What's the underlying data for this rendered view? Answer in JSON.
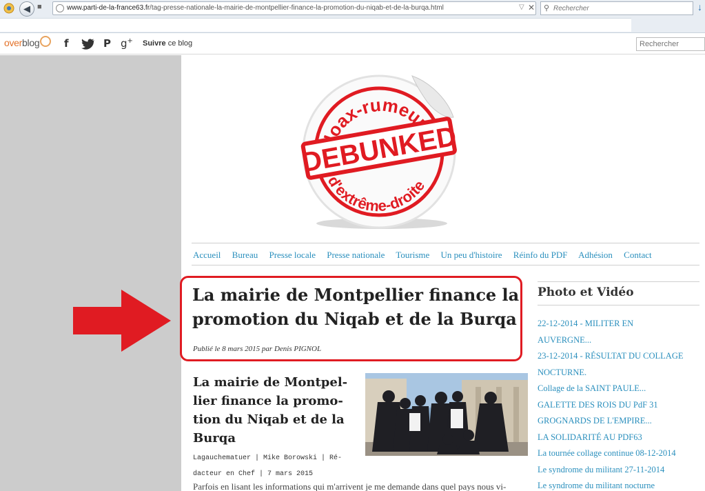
{
  "browser": {
    "url_domain": "www.parti-de-la-france63.fr",
    "url_path": "/tag-presse-nationale-la-mairie-de-montpellier-finance-la-promotion-du-niqab-et-de-la-burqa.html",
    "search_placeholder": "Rechercher"
  },
  "overblog": {
    "logo_part1": "over",
    "logo_part2": "blog",
    "follow_bold": "Suivre",
    "follow_rest": " ce blog",
    "search_placeholder": "Rechercher"
  },
  "sticker": {
    "top_text": "Hoax-rumeurs",
    "stamp_text": "DEBUNKED",
    "bottom_text": "d'extrême-droite"
  },
  "nav": [
    "Accueil",
    "Bureau",
    "Presse locale",
    "Presse nationale",
    "Tourisme",
    "Un peu d'histoire",
    "Réinfo du PDF",
    "Adhésion",
    "Contact"
  ],
  "post": {
    "title_line1": "La mairie de Montpellier finance la",
    "title_line2": "promotion du Niqab et de la Burqa",
    "byline": "Publié le 8 mars 2015 par Denis PIGNOL"
  },
  "article": {
    "title_lines": [
      "La mairie de Montpel-",
      "lier finance la promo-",
      "tion du Niqab et de la",
      "Burqa"
    ],
    "meta_line1": "Lagauchematuer | Mike Borowski | Ré-",
    "meta_line2": "dacteur en Chef | 7 mars 2015",
    "text_start": "Parfois en lisant les informations qui m'arrivent je me demande dans quel pays nous vi-"
  },
  "sidebar": {
    "title": "Photo et Vidéo",
    "items": [
      "22-12-2014 - MILITER EN",
      "AUVERGNE...",
      "23-12-2014 - RÉSULTAT DU COLLAGE",
      "NOCTURNE.",
      "Collage de la SAINT PAULE...",
      "GALETTE DES ROIS DU PdF 31",
      "GROGNARDS DE L'EMPIRE...",
      "LA SOLIDARITÉ AU PDF63",
      "La tournée collage continue 08-12-2014",
      "Le syndrome du militant 27-11-2014",
      "Le syndrome du militant nocturne"
    ]
  },
  "colors": {
    "accent_red": "#e01b22",
    "link_blue": "#2a8fbd",
    "overblog_orange": "#e3722a"
  }
}
